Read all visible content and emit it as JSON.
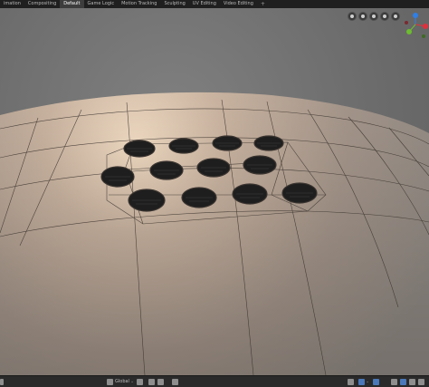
{
  "workspace_tabs": [
    {
      "label": "imation",
      "active": false
    },
    {
      "label": "Compositing",
      "active": false
    },
    {
      "label": "Default",
      "active": true
    },
    {
      "label": "Game Logic",
      "active": false
    },
    {
      "label": "Motion Tracking",
      "active": false
    },
    {
      "label": "Sculpting",
      "active": false
    },
    {
      "label": "UV Editing",
      "active": false
    },
    {
      "label": "Video Editing",
      "active": false
    }
  ],
  "add_workspace": "+",
  "viewport_buttons": [
    "grid-icon",
    "zoom-icon",
    "pan-icon",
    "camera-icon",
    "perspective-icon"
  ],
  "gizmo": {
    "axes": [
      {
        "axis": "z",
        "color": "#2f7fe6"
      },
      {
        "axis": "x",
        "color": "#e0303d"
      },
      {
        "axis": "y",
        "color": "#6cbd2f"
      }
    ]
  },
  "bottom_bar": {
    "orientation": {
      "label": "Global",
      "caret": "⌄"
    },
    "overlay_caret": "⌄"
  },
  "theme": {
    "background": "#6d6d6d",
    "mesh_light": "#f0d8bf",
    "mesh_base": "#b7a392",
    "hole_dark": "#1c1c1c",
    "topbar": "#1f1f1f",
    "active_tab": "#3d3d3d"
  }
}
